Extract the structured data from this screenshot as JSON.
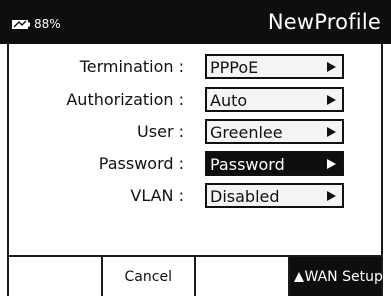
{
  "header": {
    "battery_percent": "88%",
    "title": "NewProfile",
    "battery_icon": "battery-icon"
  },
  "fields": [
    {
      "label": "Termination :",
      "value": "PPPoE",
      "icon": "right-arrow-icon"
    },
    {
      "label": "Authorization :",
      "value": "Auto",
      "icon": "right-arrow-icon"
    },
    {
      "label": "User :",
      "value": "Greenlee",
      "icon": "right-arrow-icon"
    },
    {
      "label": "Password :",
      "value": "Password",
      "icon": "right-arrow-icon",
      "selected": true
    },
    {
      "label": "VLAN :",
      "value": "Disabled",
      "icon": "right-arrow-icon"
    }
  ],
  "softkeys": [
    {
      "label": ""
    },
    {
      "label": "Cancel"
    },
    {
      "label": ""
    },
    {
      "label": "WAN Setup",
      "icon": "up-triangle-icon"
    }
  ],
  "colors": {
    "header_bg": "#0e0e0e",
    "selected_bg": "#0e0e0e",
    "field_bg": "#f4f4f4",
    "text": "#111111"
  }
}
